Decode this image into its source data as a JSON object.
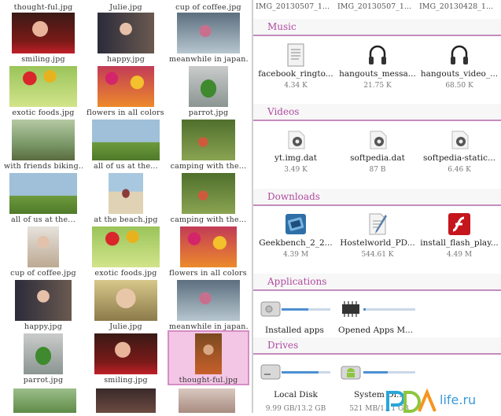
{
  "gallery": {
    "top_names": [
      "thought-ful.jpg",
      "Julie.jpg",
      "cup of coffee.jpg"
    ],
    "items": [
      {
        "name": "smiling.jpg",
        "kind": "portrait-red"
      },
      {
        "name": "happy.jpg",
        "kind": "portrait-girl"
      },
      {
        "name": "meanwhile in japan...",
        "kind": "japan"
      },
      {
        "name": "exotic foods.jpg",
        "kind": "foods"
      },
      {
        "name": "flowers in all colors...",
        "kind": "flowers"
      },
      {
        "name": "parrot.jpg",
        "kind": "parrot"
      },
      {
        "name": "with friends biking...",
        "kind": "biking"
      },
      {
        "name": "all of us at the...",
        "kind": "jump"
      },
      {
        "name": "camping with the...",
        "kind": "camping"
      },
      {
        "name": "all of us at the...",
        "kind": "jump"
      },
      {
        "name": "at the beach.jpg",
        "kind": "beach"
      },
      {
        "name": "camping with the...",
        "kind": "camping"
      },
      {
        "name": "cup of coffee.jpg",
        "kind": "coffee"
      },
      {
        "name": "exotic foods.jpg",
        "kind": "foods"
      },
      {
        "name": "flowers in all colors...",
        "kind": "flowers"
      },
      {
        "name": "happy.jpg",
        "kind": "portrait-girl"
      },
      {
        "name": "Julie.jpg",
        "kind": "julie"
      },
      {
        "name": "meanwhile in japan...",
        "kind": "japan"
      },
      {
        "name": "parrot.jpg",
        "kind": "parrot"
      },
      {
        "name": "smiling.jpg",
        "kind": "portrait-red"
      },
      {
        "name": "thought-ful.jpg",
        "kind": "thoughtful"
      }
    ],
    "selected_index": 20
  },
  "files": {
    "top_names": [
      "IMG_20130507_1...",
      "IMG_20130507_1...",
      "IMG_20130428_1..."
    ],
    "sections": [
      {
        "title": "Music",
        "items": [
          {
            "name": "facebook_ringto...",
            "size": "4.34 K",
            "icon": "document-icon"
          },
          {
            "name": "hangouts_messa...",
            "size": "21.75 K",
            "icon": "headphones-icon"
          },
          {
            "name": "hangouts_video_...",
            "size": "68.50 K",
            "icon": "headphones-icon"
          }
        ]
      },
      {
        "title": "Videos",
        "items": [
          {
            "name": "yt.img.dat",
            "size": "3.49 K",
            "icon": "gear-file-icon"
          },
          {
            "name": "softpedia.dat",
            "size": "87 B",
            "icon": "gear-file-icon"
          },
          {
            "name": "softpedia-static...",
            "size": "6.46 K",
            "icon": "gear-file-icon"
          }
        ]
      },
      {
        "title": "Downloads",
        "items": [
          {
            "name": "Geekbench_2_2...",
            "size": "4.39 M",
            "icon": "geekbench-icon"
          },
          {
            "name": "Hostelworld_PD...",
            "size": "544.61 K",
            "icon": "pen-document-icon"
          },
          {
            "name": "install_flash_play...",
            "size": "4.49 M",
            "icon": "flash-icon"
          }
        ]
      },
      {
        "title": "Applications",
        "items": [
          {
            "name": "Installed apps",
            "icon": "disk-icon",
            "usage": 0.55
          },
          {
            "name": "Opened Apps M...",
            "icon": "chip-icon",
            "usage": 0.05
          }
        ]
      },
      {
        "title": "Drives",
        "items": [
          {
            "name": "Local Disk",
            "size": "9.99 GB/13.2 GB",
            "icon": "disk-icon",
            "usage": 0.76
          },
          {
            "name": "System Di...",
            "size": "521 MB/1.11 GB",
            "icon": "android-disk-icon",
            "usage": 0.47
          }
        ]
      }
    ]
  },
  "watermark": {
    "brand": "PDA",
    "suffix": "life.ru"
  },
  "colors": {
    "accent": "#b04aa0",
    "section_line": "#c48bbf",
    "selected_bg": "#f4c6e6",
    "bar_fill": "#4c8fd1"
  }
}
